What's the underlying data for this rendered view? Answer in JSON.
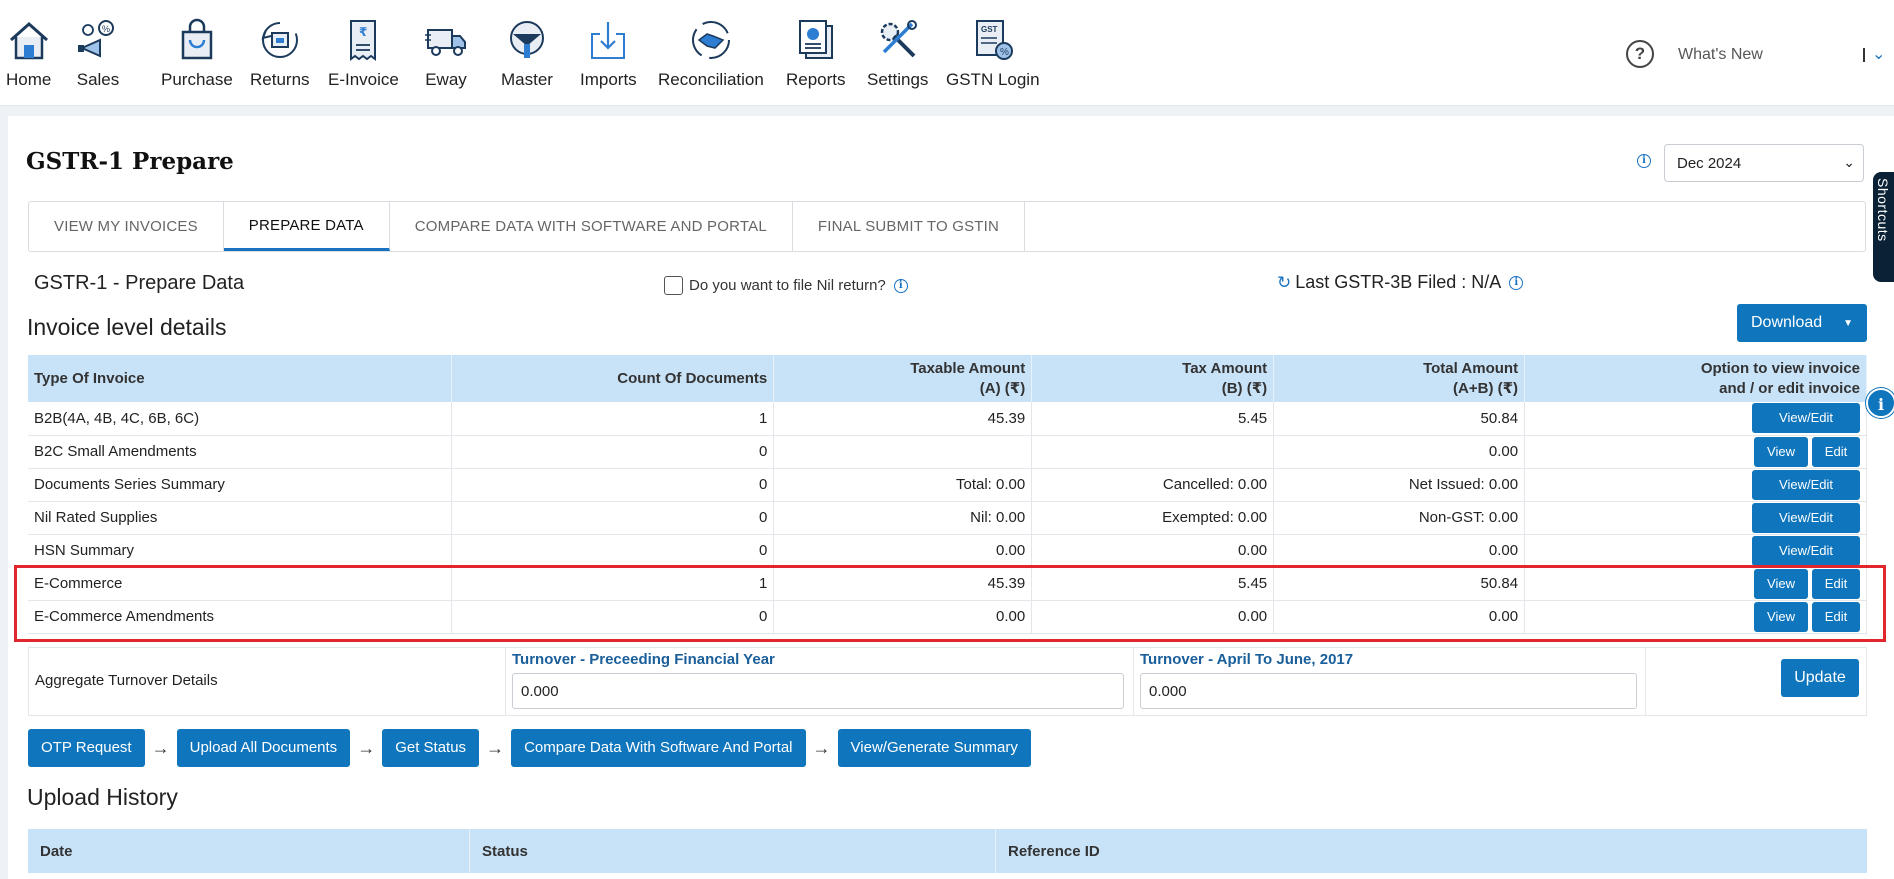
{
  "nav": {
    "items": [
      {
        "label": "Home",
        "icon": "house-icon"
      },
      {
        "label": "Sales",
        "icon": "sales-icon"
      },
      {
        "label": "Purchase",
        "icon": "shopping-bag-icon"
      },
      {
        "label": "Returns",
        "icon": "returns-icon"
      },
      {
        "label": "E-Invoice",
        "icon": "receipt-icon"
      },
      {
        "label": "Eway",
        "icon": "truck-icon"
      },
      {
        "label": "Master",
        "icon": "master-icon"
      },
      {
        "label": "Imports",
        "icon": "download-tray-icon"
      },
      {
        "label": "Reconciliation",
        "icon": "handshake-icon"
      },
      {
        "label": "Reports",
        "icon": "reports-icon"
      },
      {
        "label": "Settings",
        "icon": "tools-icon"
      },
      {
        "label": "GSTN Login",
        "icon": "gst-document-icon"
      }
    ],
    "whats_new": "What's New"
  },
  "page": {
    "title": "GSTR-1 Prepare",
    "period": "Dec 2024",
    "tabs": [
      {
        "label": "VIEW MY INVOICES",
        "active": false
      },
      {
        "label": "PREPARE DATA",
        "active": true
      },
      {
        "label": "COMPARE DATA WITH SOFTWARE AND PORTAL",
        "active": false
      },
      {
        "label": "FINAL SUBMIT TO GSTIN",
        "active": false
      }
    ],
    "subtitle": "GSTR-1  - Prepare Data",
    "nil_return_label": "Do you want to file Nil return?",
    "last_filed": "Last GSTR-3B Filed : N/A",
    "section_title": "Invoice level details",
    "download_label": "Download",
    "shortcuts_label": "Shortcuts"
  },
  "table": {
    "headers": {
      "type": "Type Of Invoice",
      "count": "Count Of Documents",
      "taxable_1": "Taxable Amount",
      "taxable_2": "(A) (₹)",
      "tax_1": "Tax Amount",
      "tax_2": "(B) (₹)",
      "total_1": "Total Amount",
      "total_2": "(A+B) (₹)",
      "option_1": "Option to view invoice",
      "option_2": "and / or edit invoice"
    },
    "rows": [
      {
        "type": "B2B(4A, 4B, 4C, 6B, 6C)",
        "count": "1",
        "taxable": "45.39",
        "tax": "5.45",
        "total": "50.84",
        "actions": [
          "View/Edit"
        ]
      },
      {
        "type": "B2C Small Amendments",
        "count": "0",
        "taxable": "",
        "tax": "",
        "total": "0.00",
        "actions": [
          "View",
          "Edit"
        ]
      },
      {
        "type": "Documents Series Summary",
        "count": "0",
        "taxable": "Total: 0.00",
        "tax": "Cancelled: 0.00",
        "total": "Net Issued: 0.00",
        "actions": [
          "View/Edit"
        ]
      },
      {
        "type": "Nil Rated Supplies",
        "count": "0",
        "taxable": "Nil: 0.00",
        "tax": "Exempted: 0.00",
        "total": "Non-GST: 0.00",
        "actions": [
          "View/Edit"
        ]
      },
      {
        "type": "HSN Summary",
        "count": "0",
        "taxable": "0.00",
        "tax": "0.00",
        "total": "0.00",
        "actions": [
          "View/Edit"
        ]
      },
      {
        "type": "E-Commerce",
        "count": "1",
        "taxable": "45.39",
        "tax": "5.45",
        "total": "50.84",
        "actions": [
          "View",
          "Edit"
        ]
      },
      {
        "type": "E-Commerce Amendments",
        "count": "0",
        "taxable": "0.00",
        "tax": "0.00",
        "total": "0.00",
        "actions": [
          "View",
          "Edit"
        ]
      }
    ]
  },
  "aggregate": {
    "label": "Aggregate Turnover Details",
    "preceding_label": "Turnover - Preceeding Financial Year",
    "preceding_value": "0.000",
    "april_june_label": "Turnover - April To June, 2017",
    "april_june_value": "0.000",
    "update_label": "Update"
  },
  "steps": [
    "OTP Request",
    "Upload All Documents",
    "Get Status",
    "Compare Data With Software And Portal",
    "View/Generate Summary"
  ],
  "upload_history": {
    "title": "Upload History",
    "columns": [
      "Date",
      "Status",
      "Reference ID"
    ]
  },
  "colors": {
    "primary": "#0f75bc",
    "header_bg": "#c8e2f8",
    "highlight": "#e1262d"
  }
}
